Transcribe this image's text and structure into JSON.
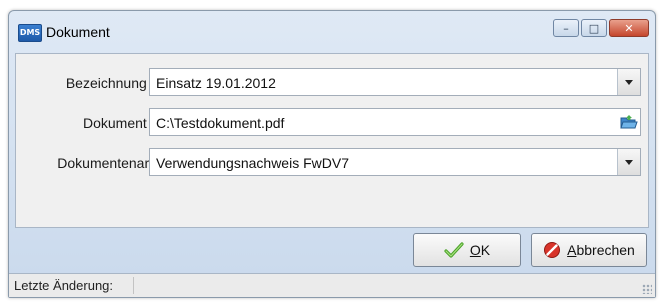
{
  "window": {
    "title": "Dokument",
    "app_icon_text": "DMS"
  },
  "form": {
    "bezeichnung": {
      "label": "Bezeichnung",
      "required_mark": "•",
      "value": "Einsatz 19.01.2012"
    },
    "dokument": {
      "label": "Dokument",
      "required_mark": "•",
      "value": "C:\\Testdokument.pdf"
    },
    "dokumentenart": {
      "label": "Dokumentenart",
      "value": "Verwendungsnachweis FwDV7"
    }
  },
  "buttons": {
    "ok": {
      "label": "OK",
      "mnemonic": "O",
      "rest": "K",
      "icon": "checkmark-icon"
    },
    "cancel": {
      "label": "Abbrechen",
      "mnemonic": "A",
      "rest": "bbrechen",
      "icon": "cancel-icon"
    }
  },
  "status": {
    "last_change_label": "Letzte Änderung:"
  },
  "colors": {
    "required": "#d01818",
    "titlebar": "#c9d9ec",
    "close_button": "#c5462c"
  }
}
